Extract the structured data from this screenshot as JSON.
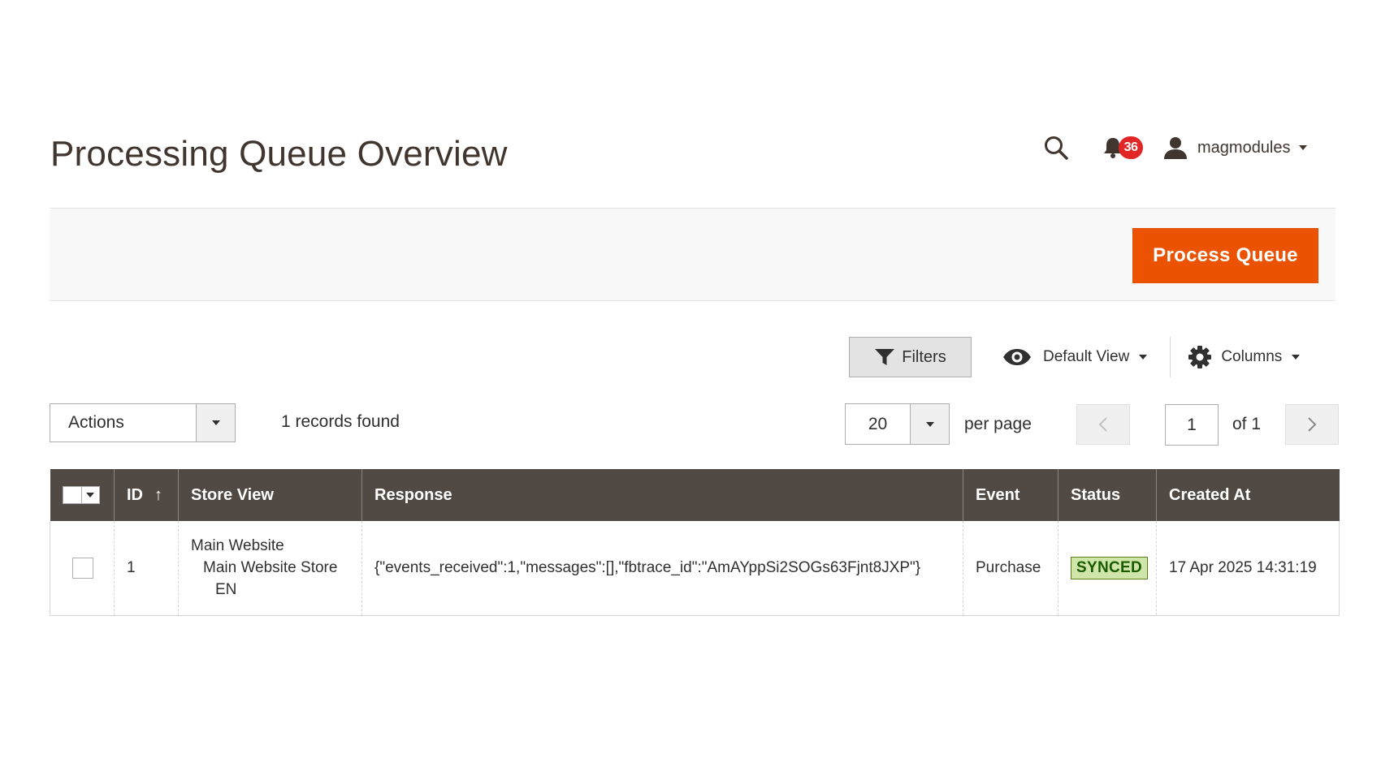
{
  "header": {
    "title": "Processing Queue Overview",
    "notifications_count": "36",
    "user_name": "magmodules"
  },
  "page_actions": {
    "process_queue_label": "Process Queue"
  },
  "grid_controls": {
    "filters_label": "Filters",
    "view_label": "Default View",
    "columns_label": "Columns"
  },
  "toolbar": {
    "actions_label": "Actions",
    "records_found": "1 records found",
    "per_page_value": "20",
    "per_page_label": "per page",
    "page_value": "1",
    "page_of": "of 1"
  },
  "table": {
    "columns": [
      "ID",
      "Store View",
      "Response",
      "Event",
      "Status",
      "Created At"
    ],
    "sort_indicator": "↑",
    "rows": [
      {
        "id": "1",
        "store_view": [
          "Main Website",
          "Main Website Store",
          "EN"
        ],
        "response": "{\"events_received\":1,\"messages\":[],\"fbtrace_id\":\"AmAYppSi2SOGs63Fjnt8JXP\"}",
        "event": "Purchase",
        "status": "SYNCED",
        "created_at": "17 Apr 2025 14:31:19"
      }
    ]
  },
  "colors": {
    "accent": "#eb5202",
    "header_bg": "#514943",
    "badge_red": "#e22626",
    "status_green_bg": "#d0e5a9"
  },
  "icons": [
    "search-icon",
    "bell-icon",
    "user-icon",
    "filter-icon",
    "eye-icon",
    "gear-icon",
    "chevron-left-icon",
    "chevron-right-icon"
  ]
}
